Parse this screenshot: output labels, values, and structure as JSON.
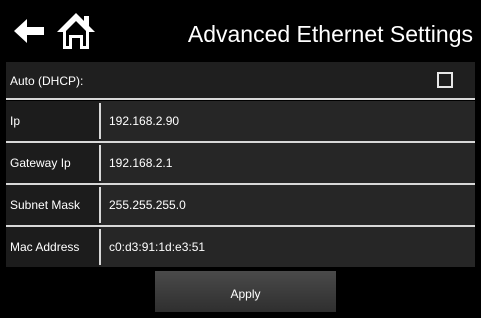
{
  "header": {
    "title": "Advanced Ethernet Settings",
    "back_icon": "left-arrow-icon",
    "home_icon": "home-icon"
  },
  "dhcp": {
    "label": "Auto (DHCP):",
    "checked": false
  },
  "fields": [
    {
      "label": "Ip",
      "value": "192.168.2.90"
    },
    {
      "label": "Gateway Ip",
      "value": "192.168.2.1"
    },
    {
      "label": "Subnet Mask",
      "value": "255.255.255.0"
    },
    {
      "label": "Mac Address",
      "value": "c0:d3:91:1d:e3:51"
    }
  ],
  "apply_label": "Apply",
  "colors": {
    "background": "#000000",
    "row": "#222222",
    "separator": "#d8d8d8",
    "text": "#ffffff"
  }
}
